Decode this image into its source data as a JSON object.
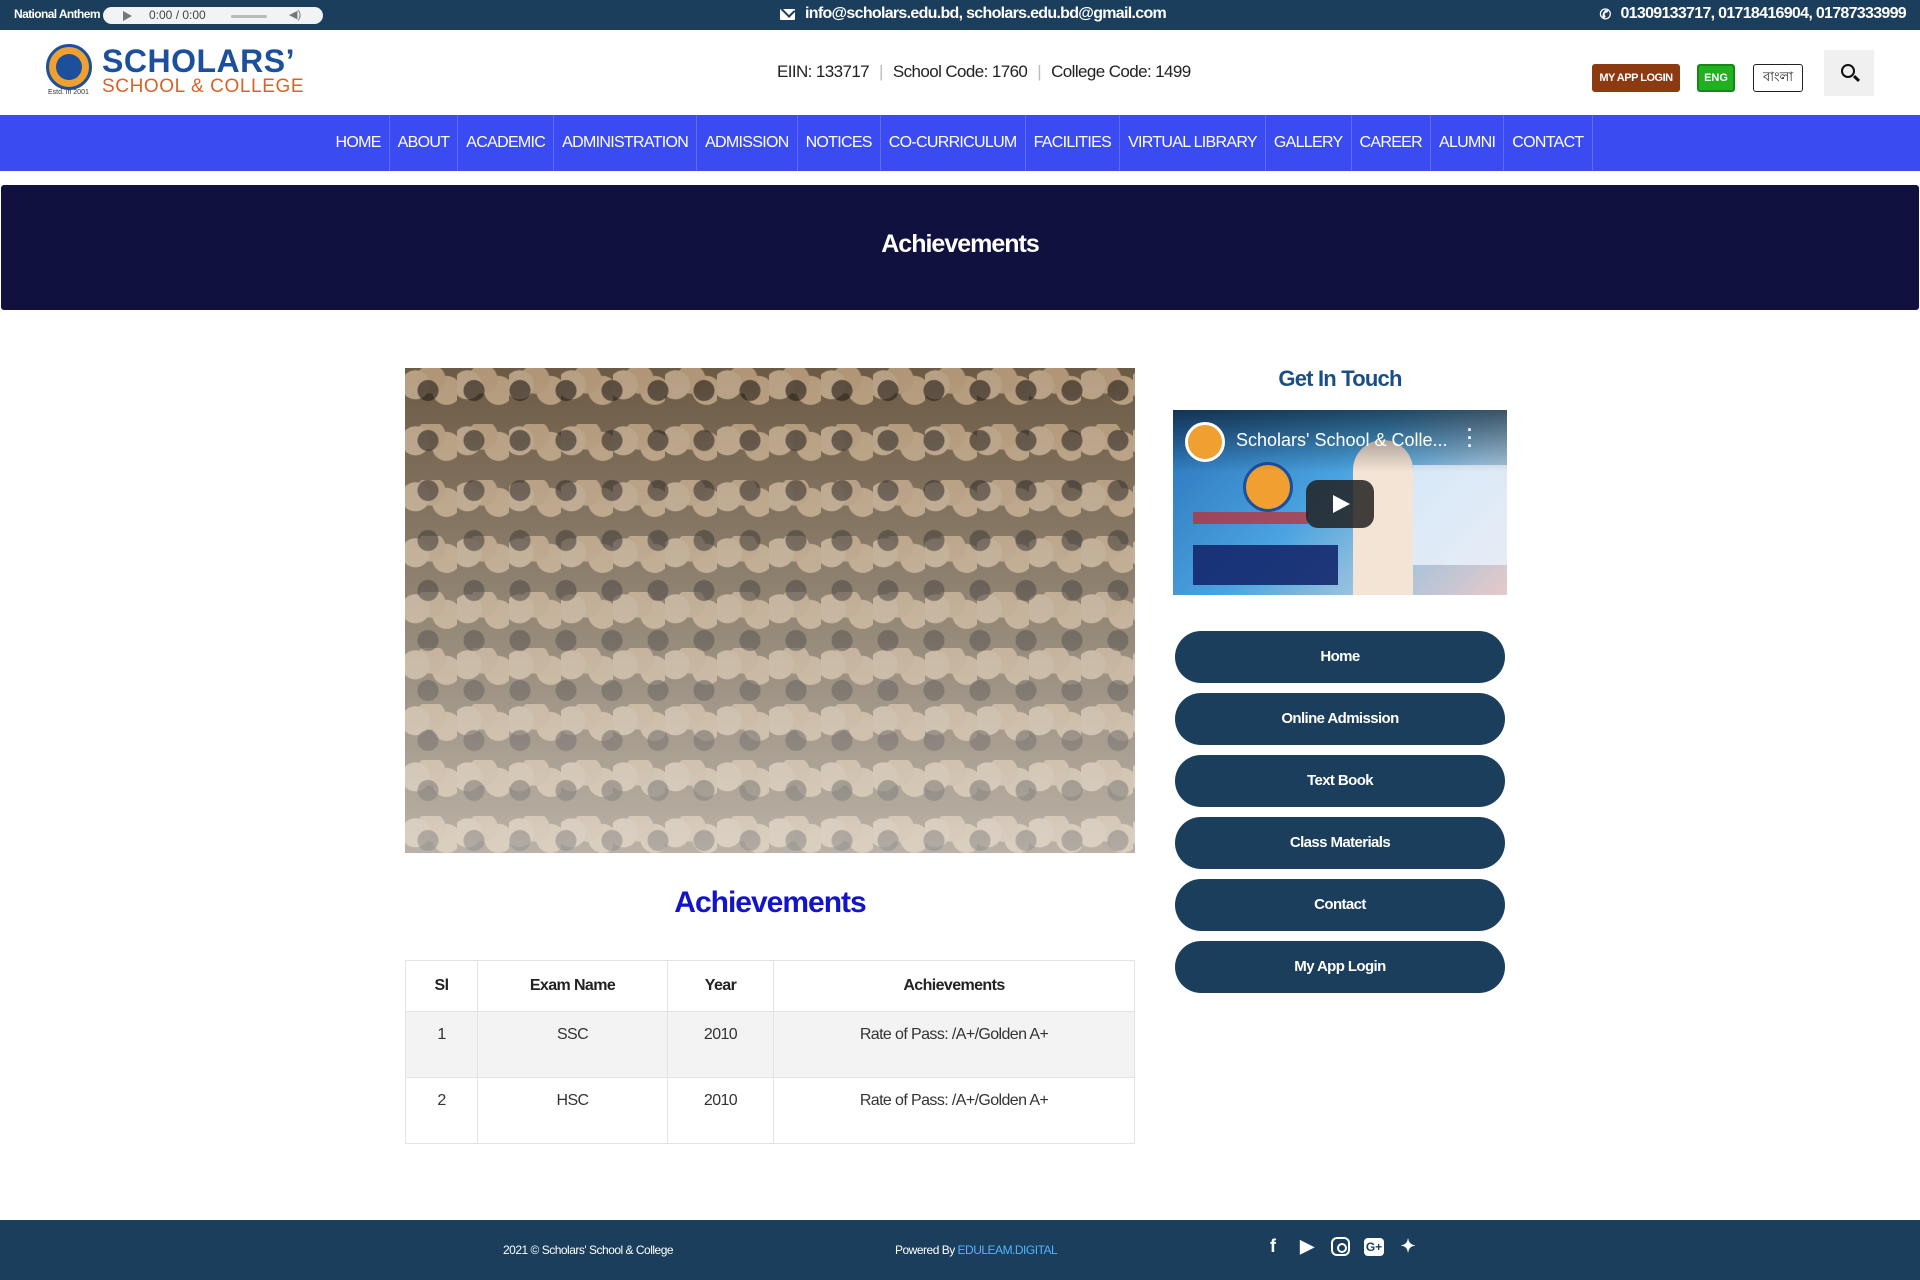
{
  "topbar": {
    "anthem_label": "National Anthem",
    "audio_time": "0:00 / 0:00",
    "email": "info@scholars.edu.bd, scholars.edu.bd@gmail.com",
    "phone": "01309133717, 01718416904, 01787333999"
  },
  "header": {
    "logo_line1": "SCHOLARS’",
    "logo_line2": "SCHOOL & COLLEGE",
    "logo_estd": "Estd. in 2001",
    "eiin": "EIIN: 133717",
    "school_code": "School Code: 1760",
    "college_code": "College Code: 1499",
    "app_login_label": "MY APP LOGIN",
    "eng_label": "ENG",
    "bangla_label": "বাংলা"
  },
  "nav": [
    "HOME",
    "ABOUT",
    "ACADEMIC",
    "ADMINISTRATION",
    "ADMISSION",
    "NOTICES",
    "CO-CURRICULUM",
    "FACILITIES",
    "VIRTUAL LIBRARY",
    "GALLERY",
    "CAREER",
    "ALUMNI",
    "CONTACT"
  ],
  "banner": {
    "title": "Achievements"
  },
  "content": {
    "section_title": "Achievements",
    "table": {
      "headers": [
        "Sl",
        "Exam Name",
        "Year",
        "Achievements"
      ],
      "rows": [
        {
          "sl": "1",
          "exam": "SSC",
          "year": "2010",
          "achievement": "Rate of Pass: /A+/Golden A+"
        },
        {
          "sl": "2",
          "exam": "HSC",
          "year": "2010",
          "achievement": "Rate of Pass: /A+/Golden A+"
        }
      ]
    }
  },
  "sidebar": {
    "title": "Get In Touch",
    "video_title": "Scholars' School & Colle...",
    "buttons": [
      "Home",
      "Online Admission",
      "Text Book",
      "Class Materials",
      "Contact",
      "My App Login"
    ]
  },
  "footer": {
    "copyright": "2021 © Scholars' School & College",
    "powered_prefix": "Powered By ",
    "powered_brand": "EDULEAM.DIGITAL",
    "social_icons": [
      "facebook-icon",
      "youtube-icon",
      "instagram-icon",
      "google-plus-icon",
      "twitter-icon"
    ]
  },
  "colors": {
    "topbar": "#1a3e5c",
    "navbar": "#3b4bf2",
    "banner": "#11113f",
    "section_title": "#1313c9",
    "side_button": "#1a3e5c",
    "app_login_button": "#8b3a12",
    "eng_button": "#20b020"
  }
}
